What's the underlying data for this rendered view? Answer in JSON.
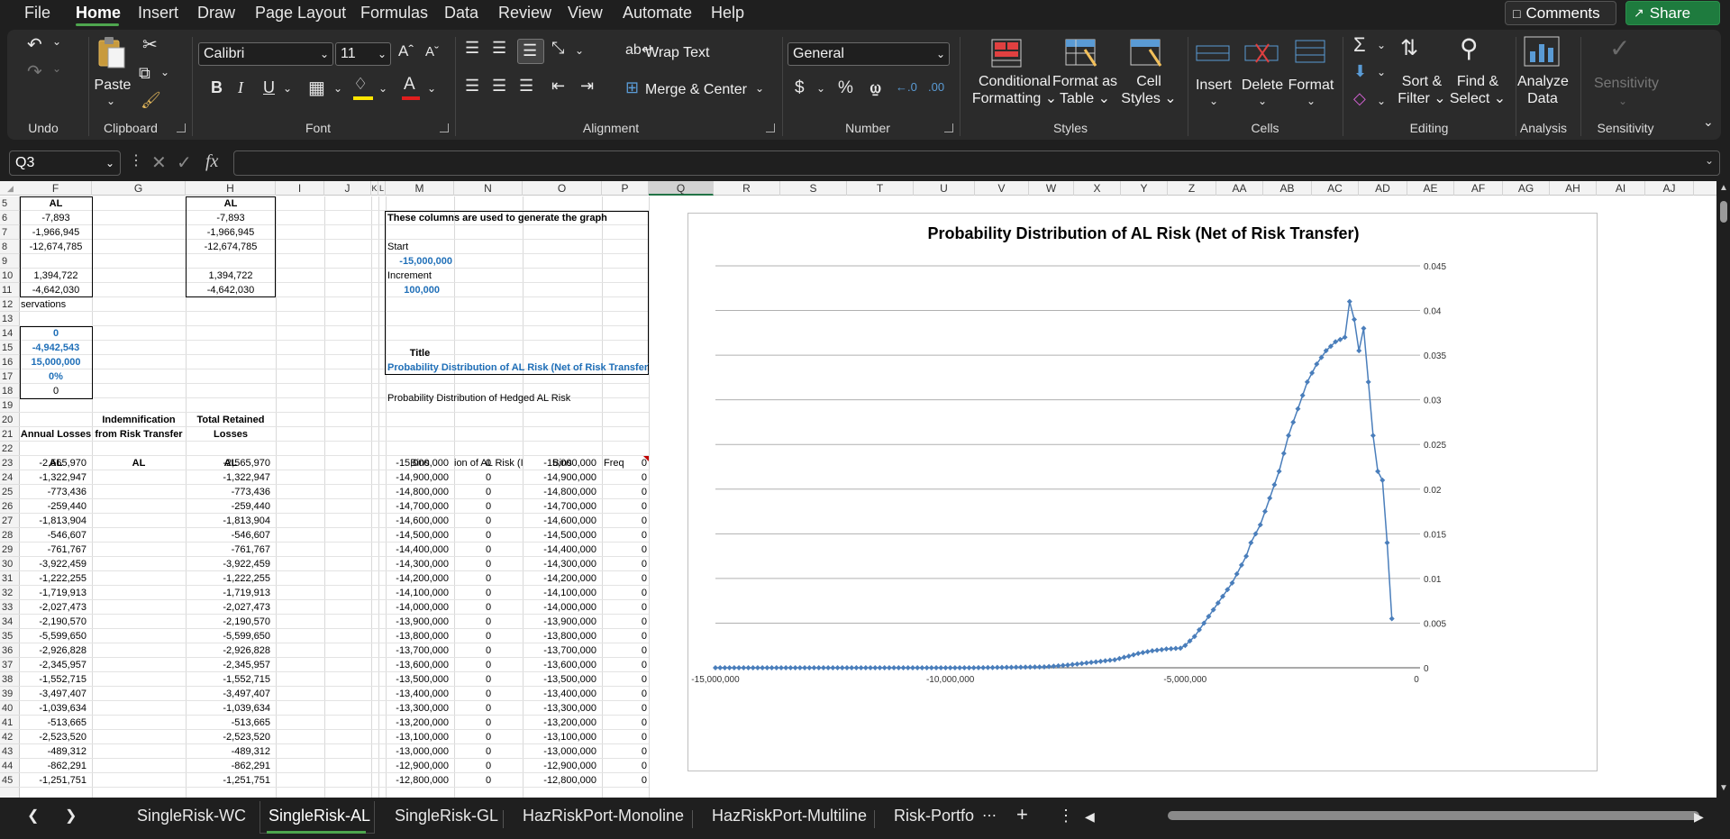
{
  "menu": {
    "items": [
      "File",
      "Home",
      "Insert",
      "Draw",
      "Page Layout",
      "Formulas",
      "Data",
      "Review",
      "View",
      "Automate",
      "Help"
    ],
    "comments": "Comments",
    "share": "Share"
  },
  "ribbon": {
    "groups": [
      "Undo",
      "Clipboard",
      "Font",
      "Alignment",
      "Number",
      "Styles",
      "Cells",
      "Editing",
      "Analysis",
      "Sensitivity"
    ],
    "paste": "Paste",
    "font_name": "Calibri",
    "font_size": "11",
    "wrap_text": "Wrap Text",
    "merge_center": "Merge & Center",
    "number_format": "General",
    "conditional_formatting": [
      "Conditional",
      "Formatting"
    ],
    "format_as_table": [
      "Format as",
      "Table"
    ],
    "cell_styles": [
      "Cell",
      "Styles"
    ],
    "insert": "Insert",
    "delete": "Delete",
    "format": "Format",
    "sort_filter": [
      "Sort &",
      "Filter"
    ],
    "find_select": [
      "Find &",
      "Select"
    ],
    "analyze_data": [
      "Analyze",
      "Data"
    ],
    "sensitivity": "Sensitivity",
    "accent": "#4ea64e"
  },
  "formula_bar": {
    "name_box": "Q3",
    "formula": "",
    "fx": "fx"
  },
  "columns": [
    "F",
    "G",
    "H",
    "I",
    "J",
    "K",
    "L",
    "M",
    "N",
    "O",
    "P",
    "Q",
    "R",
    "S",
    "T",
    "U",
    "V",
    "W",
    "X",
    "Y",
    "Z",
    "AA",
    "AB",
    "AC",
    "AD",
    "AE",
    "AF",
    "AG",
    "AH",
    "AI",
    "AJ"
  ],
  "selected_column": "Q",
  "rows": [
    5,
    6,
    7,
    8,
    9,
    10,
    11,
    12,
    13,
    14,
    15,
    16,
    17,
    18,
    19,
    20,
    21,
    22,
    23,
    24,
    25,
    26,
    27,
    28,
    29,
    30,
    31,
    32,
    33,
    34,
    35,
    36,
    37,
    38,
    39,
    40,
    41,
    42,
    43,
    44,
    45
  ],
  "top_block": {
    "f": [
      "AL",
      "-7,893",
      "-1,966,945",
      "-12,674,785",
      "",
      "1,394,722",
      "-4,642,030"
    ],
    "h": [
      "AL",
      "-7,893",
      "-1,966,945",
      "-12,674,785",
      "",
      "1,394,722",
      "-4,642,030"
    ],
    "r12": "servations"
  },
  "stats_block": [
    "0",
    "-4,942,543",
    "15,000,000",
    "0%",
    "0"
  ],
  "headers": {
    "annual_losses": "Annual Losses",
    "indemnification": [
      "Indemnification",
      "from Risk Transfer"
    ],
    "total_retained": [
      "Total Retained",
      "Losses"
    ],
    "al": "AL",
    "bins": "Bins",
    "n22": "ion of AL Risk (I",
    "freq": "Freq"
  },
  "graph_box": {
    "heading": "These columns are used to generate the graph",
    "start_label": "Start",
    "start_value": "-15,000,000",
    "increment_label": "Increment",
    "increment_value": "100,000",
    "title_label": "Title",
    "title_value": "Probability Distribution of AL Risk (Net of Risk Transfer)",
    "hedged_label": "Probability Distribution of Hedged AL Risk"
  },
  "table_rows": [
    {
      "f": "-2,565,970",
      "h": "-2,565,970",
      "m": "-15,000,000",
      "n": "0",
      "o": "-15,000,000",
      "p": "0"
    },
    {
      "f": "-1,322,947",
      "h": "-1,322,947",
      "m": "-14,900,000",
      "n": "0",
      "o": "-14,900,000",
      "p": "0"
    },
    {
      "f": "-773,436",
      "h": "-773,436",
      "m": "-14,800,000",
      "n": "0",
      "o": "-14,800,000",
      "p": "0"
    },
    {
      "f": "-259,440",
      "h": "-259,440",
      "m": "-14,700,000",
      "n": "0",
      "o": "-14,700,000",
      "p": "0"
    },
    {
      "f": "-1,813,904",
      "h": "-1,813,904",
      "m": "-14,600,000",
      "n": "0",
      "o": "-14,600,000",
      "p": "0"
    },
    {
      "f": "-546,607",
      "h": "-546,607",
      "m": "-14,500,000",
      "n": "0",
      "o": "-14,500,000",
      "p": "0"
    },
    {
      "f": "-761,767",
      "h": "-761,767",
      "m": "-14,400,000",
      "n": "0",
      "o": "-14,400,000",
      "p": "0"
    },
    {
      "f": "-3,922,459",
      "h": "-3,922,459",
      "m": "-14,300,000",
      "n": "0",
      "o": "-14,300,000",
      "p": "0"
    },
    {
      "f": "-1,222,255",
      "h": "-1,222,255",
      "m": "-14,200,000",
      "n": "0",
      "o": "-14,200,000",
      "p": "0"
    },
    {
      "f": "-1,719,913",
      "h": "-1,719,913",
      "m": "-14,100,000",
      "n": "0",
      "o": "-14,100,000",
      "p": "0"
    },
    {
      "f": "-2,027,473",
      "h": "-2,027,473",
      "m": "-14,000,000",
      "n": "0",
      "o": "-14,000,000",
      "p": "0"
    },
    {
      "f": "-2,190,570",
      "h": "-2,190,570",
      "m": "-13,900,000",
      "n": "0",
      "o": "-13,900,000",
      "p": "0"
    },
    {
      "f": "-5,599,650",
      "h": "-5,599,650",
      "m": "-13,800,000",
      "n": "0",
      "o": "-13,800,000",
      "p": "0"
    },
    {
      "f": "-2,926,828",
      "h": "-2,926,828",
      "m": "-13,700,000",
      "n": "0",
      "o": "-13,700,000",
      "p": "0"
    },
    {
      "f": "-2,345,957",
      "h": "-2,345,957",
      "m": "-13,600,000",
      "n": "0",
      "o": "-13,600,000",
      "p": "0"
    },
    {
      "f": "-1,552,715",
      "h": "-1,552,715",
      "m": "-13,500,000",
      "n": "0",
      "o": "-13,500,000",
      "p": "0"
    },
    {
      "f": "-3,497,407",
      "h": "-3,497,407",
      "m": "-13,400,000",
      "n": "0",
      "o": "-13,400,000",
      "p": "0"
    },
    {
      "f": "-1,039,634",
      "h": "-1,039,634",
      "m": "-13,300,000",
      "n": "0",
      "o": "-13,300,000",
      "p": "0"
    },
    {
      "f": "-513,665",
      "h": "-513,665",
      "m": "-13,200,000",
      "n": "0",
      "o": "-13,200,000",
      "p": "0"
    },
    {
      "f": "-2,523,520",
      "h": "-2,523,520",
      "m": "-13,100,000",
      "n": "0",
      "o": "-13,100,000",
      "p": "0"
    },
    {
      "f": "-489,312",
      "h": "-489,312",
      "m": "-13,000,000",
      "n": "0",
      "o": "-13,000,000",
      "p": "0"
    },
    {
      "f": "-862,291",
      "h": "-862,291",
      "m": "-12,900,000",
      "n": "0",
      "o": "-12,900,000",
      "p": "0"
    },
    {
      "f": "-1,251,751",
      "h": "-1,251,751",
      "m": "-12,800,000",
      "n": "0",
      "o": "-12,800,000",
      "p": "0"
    }
  ],
  "sheet_tabs": [
    "SingleRisk-WC",
    "SingleRisk-AL",
    "SingleRisk-GL",
    "HazRiskPort-Monoline",
    "HazRiskPort-Multiline",
    "Risk-Portfo"
  ],
  "active_tab": "SingleRisk-AL",
  "chart_data": {
    "type": "line",
    "title": "Probability Distribution of AL Risk (Net of Risk Transfer)",
    "xlim": [
      -15000000,
      0
    ],
    "ylim": [
      0,
      0.045
    ],
    "xticks": [
      -15000000,
      -10000000,
      -5000000,
      0
    ],
    "xtick_labels": [
      "-15,000,000",
      "-10,000,000",
      "-5,000,000",
      "0"
    ],
    "yticks": [
      0,
      0.005,
      0.01,
      0.015,
      0.02,
      0.025,
      0.03,
      0.035,
      0.04,
      0.045
    ],
    "ytick_labels": [
      "0",
      "0.005",
      "0.01",
      "0.015",
      "0.02",
      "0.025",
      "0.03",
      "0.035",
      "0.04",
      "0.045"
    ],
    "y_axis_side": "right",
    "grid": true,
    "legend": false,
    "series_color": "#4a7ebb",
    "marker": "diamond",
    "keypoints": [
      [
        -15000000,
        0
      ],
      [
        -9500000,
        0
      ],
      [
        -8000000,
        0.0001
      ],
      [
        -7500000,
        0.0003
      ],
      [
        -7000000,
        0.0006
      ],
      [
        -6500000,
        0.0009
      ],
      [
        -6200000,
        0.0013
      ],
      [
        -6000000,
        0.0016
      ],
      [
        -5700000,
        0.0019
      ],
      [
        -5400000,
        0.0021
      ],
      [
        -5100000,
        0.0022
      ],
      [
        -5000000,
        0.0025
      ],
      [
        -4800000,
        0.0035
      ],
      [
        -4600000,
        0.005
      ],
      [
        -4400000,
        0.0065
      ],
      [
        -4200000,
        0.008
      ],
      [
        -4000000,
        0.0095
      ],
      [
        -3800000,
        0.0115
      ],
      [
        -3700000,
        0.0125
      ],
      [
        -3600000,
        0.014
      ],
      [
        -3400000,
        0.016
      ],
      [
        -3200000,
        0.019
      ],
      [
        -3000000,
        0.022
      ],
      [
        -2800000,
        0.026
      ],
      [
        -2600000,
        0.029
      ],
      [
        -2400000,
        0.032
      ],
      [
        -2200000,
        0.034
      ],
      [
        -2000000,
        0.0355
      ],
      [
        -1800000,
        0.0365
      ],
      [
        -1600000,
        0.037
      ],
      [
        -1500000,
        0.041
      ],
      [
        -1400000,
        0.039
      ],
      [
        -1300000,
        0.0355
      ],
      [
        -1200000,
        0.038
      ],
      [
        -1100000,
        0.032
      ],
      [
        -1000000,
        0.026
      ],
      [
        -900000,
        0.022
      ],
      [
        -800000,
        0.021
      ],
      [
        -700000,
        0.014
      ],
      [
        -600000,
        0.0055
      ]
    ]
  }
}
